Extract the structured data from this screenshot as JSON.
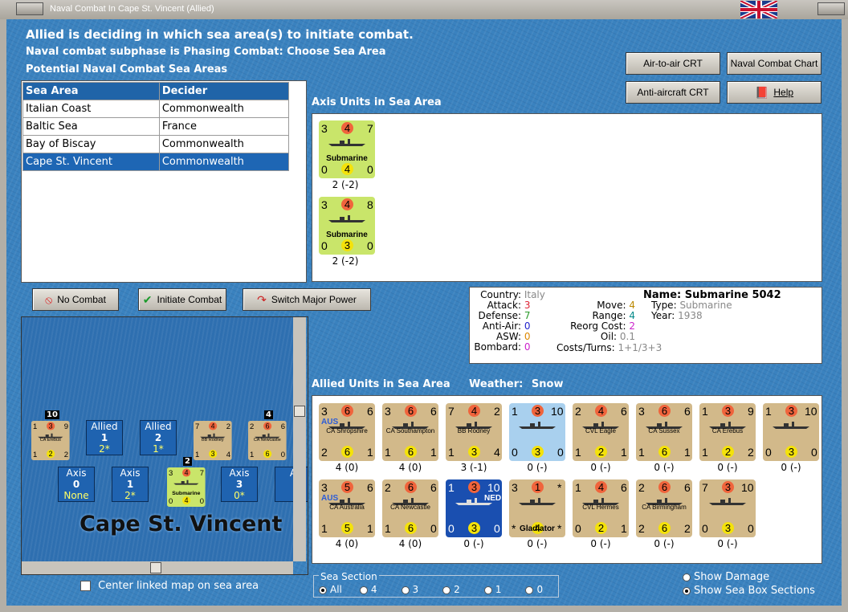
{
  "window": {
    "title": "Naval Combat In Cape St. Vincent (Allied)"
  },
  "header": {
    "line1": "Allied is deciding in which sea area(s) to initiate combat.",
    "line2": "Naval combat subphase is Phasing Combat: Choose Sea Area",
    "line3": "Potential Naval Combat Sea Areas"
  },
  "buttons": {
    "air_to_air": "Air-to-air CRT",
    "naval_chart": "Naval Combat Chart",
    "anti_aircraft": "Anti-aircraft CRT",
    "help": "Help",
    "no_combat": "No Combat",
    "initiate_combat": "Initiate Combat",
    "switch_major": "Switch Major Power"
  },
  "sea_table": {
    "headers": [
      "Sea Area",
      "Decider"
    ],
    "rows": [
      {
        "area": "Italian Coast",
        "decider": "Commonwealth"
      },
      {
        "area": "Baltic Sea",
        "decider": "France"
      },
      {
        "area": "Bay of Biscay",
        "decider": "Commonwealth"
      },
      {
        "area": "Cape St. Vincent",
        "decider": "Commonwealth"
      }
    ]
  },
  "axis_units": {
    "title": "Axis Units in Sea Area",
    "units": [
      {
        "tl": "3",
        "tc": "4",
        "tr": "7",
        "name": "Submarine",
        "bl": "0",
        "bc": "4",
        "br": "0",
        "under": "2 (-2)"
      },
      {
        "tl": "3",
        "tc": "4",
        "tr": "8",
        "name": "Submarine",
        "bl": "0",
        "bc": "3",
        "br": "0",
        "under": "2 (-2)"
      }
    ]
  },
  "info": {
    "country_k": "Country:",
    "country_v": "Italy",
    "attack_k": "Attack:",
    "attack_v": "3",
    "defense_k": "Defense:",
    "defense_v": "7",
    "antiair_k": "Anti-Air:",
    "antiair_v": "0",
    "asw_k": "ASW:",
    "asw_v": "0",
    "bombard_k": "Bombard:",
    "bombard_v": "0",
    "name_k": "Name:",
    "name_v": "Submarine 5042",
    "type_k": "Type:",
    "type_v": "Submarine",
    "year_k": "Year:",
    "year_v": "1938",
    "move_k": "Move:",
    "move_v": "4",
    "range_k": "Range:",
    "range_v": "4",
    "reorg_k": "Reorg Cost:",
    "reorg_v": "2",
    "oil_k": "Oil:",
    "oil_v": "0.1",
    "costs_k": "Costs/Turns:",
    "costs_v": "1+1/3+3"
  },
  "allied_units": {
    "title": "Allied Units in Sea Area",
    "weather_label": "Weather:",
    "weather_value": "Snow",
    "units": [
      {
        "tl": "3",
        "tc": "6",
        "tr": "6",
        "name": "CA Shropshire",
        "tag": "AUS",
        "bl": "2",
        "bc": "6",
        "br": "1",
        "under": "4 (0)",
        "bg": "#d2b98a"
      },
      {
        "tl": "3",
        "tc": "6",
        "tr": "6",
        "name": "CA Southampton",
        "tag": "",
        "bl": "1",
        "bc": "6",
        "br": "1",
        "under": "4 (0)",
        "bg": "#d2b98a"
      },
      {
        "tl": "7",
        "tc": "4",
        "tr": "2",
        "name": "BB Rodney",
        "tag": "",
        "bl": "1",
        "bc": "3",
        "br": "4",
        "under": "3 (-1)",
        "bg": "#d2b98a"
      },
      {
        "tl": "1",
        "tc": "3",
        "tr": "10",
        "name": "",
        "tag": "",
        "bl": "0",
        "bc": "3",
        "br": "0",
        "under": "0 (-)",
        "bg": "#a9d0ee"
      },
      {
        "tl": "2",
        "tc": "4",
        "tr": "6",
        "name": "CVL Eagle",
        "tag": "",
        "bl": "1",
        "bc": "2",
        "br": "1",
        "under": "0 (-)",
        "bg": "#d2b98a"
      },
      {
        "tl": "3",
        "tc": "6",
        "tr": "6",
        "name": "CA Sussex",
        "tag": "",
        "bl": "1",
        "bc": "6",
        "br": "1",
        "under": "0 (-)",
        "bg": "#d2b98a"
      },
      {
        "tl": "1",
        "tc": "3",
        "tr": "9",
        "name": "CA Erebus",
        "tag": "",
        "bl": "1",
        "bc": "2",
        "br": "2",
        "under": "0 (-)",
        "bg": "#d2b98a"
      },
      {
        "tl": "1",
        "tc": "3",
        "tr": "10",
        "name": "",
        "tag": "",
        "bl": "0",
        "bc": "3",
        "br": "0",
        "under": "0 (-)",
        "bg": "#d2b98a"
      },
      {
        "tl": "3",
        "tc": "5",
        "tr": "6",
        "name": "CA Australia",
        "tag": "AUS",
        "bl": "1",
        "bc": "5",
        "br": "1",
        "under": "4 (0)",
        "bg": "#d2b98a"
      },
      {
        "tl": "2",
        "tc": "6",
        "tr": "6",
        "name": "CA Newcastle",
        "tag": "",
        "bl": "1",
        "bc": "6",
        "br": "0",
        "under": "4 (0)",
        "bg": "#d2b98a"
      },
      {
        "tl": "1",
        "tc": "3",
        "tr": "10",
        "name": "",
        "tag": "NED",
        "bl": "0",
        "bc": "3",
        "br": "0",
        "under": "0 (-)",
        "bg": "#1a4fb0"
      },
      {
        "tl": "3",
        "tc": "1",
        "tr": "*",
        "name": "Gladiator",
        "tag": "",
        "bl": "*",
        "bc": "4",
        "br": "*",
        "under": "0 (-)",
        "bg": "#d2b98a"
      },
      {
        "tl": "1",
        "tc": "4",
        "tr": "6",
        "name": "CVL Hermes",
        "tag": "",
        "bl": "0",
        "bc": "2",
        "br": "1",
        "under": "0 (-)",
        "bg": "#d2b98a"
      },
      {
        "tl": "2",
        "tc": "6",
        "tr": "6",
        "name": "CA Birmingham",
        "tag": "",
        "bl": "2",
        "bc": "6",
        "br": "2",
        "under": "0 (-)",
        "bg": "#d2b98a"
      },
      {
        "tl": "7",
        "tc": "3",
        "tr": "10",
        "name": "",
        "tag": "",
        "bl": "0",
        "bc": "3",
        "br": "0",
        "under": "0 (-)",
        "bg": "#d2b98a"
      }
    ]
  },
  "map": {
    "sea_name": "Cape St. Vincent",
    "allied_boxes": [
      {
        "label": "Allied",
        "num": "1",
        "sub": "2*"
      },
      {
        "label": "Allied",
        "num": "2",
        "sub": "1*"
      }
    ],
    "axis_boxes": [
      {
        "label": "Axis",
        "num": "0",
        "sub": "None"
      },
      {
        "label": "Axis",
        "num": "1",
        "sub": "2*"
      },
      {
        "label": "Axis",
        "num": "3",
        "sub": "0*"
      },
      {
        "label": "A",
        "num": "",
        "sub": ""
      }
    ],
    "stack_counts": [
      "10",
      "4",
      "2"
    ],
    "map_counters": [
      {
        "tl": "1",
        "tc": "3",
        "tr": "9",
        "name": "CA Erebus",
        "bl": "1",
        "bc": "2",
        "br": "2"
      },
      {
        "tl": "7",
        "tc": "4",
        "tr": "2",
        "name": "BB Rodney",
        "bl": "1",
        "bc": "3",
        "br": "4"
      },
      {
        "tl": "2",
        "tc": "6",
        "tr": "6",
        "name": "CA Newcastle",
        "bl": "1",
        "bc": "6",
        "br": "0"
      },
      {
        "tl": "3",
        "tc": "4",
        "tr": "7",
        "name": "Submarine",
        "bl": "0",
        "bc": "4",
        "br": "0"
      }
    ]
  },
  "options": {
    "center_linked": "Center linked map on sea area",
    "sea_section_label": "Sea Section",
    "sections": [
      "All",
      "4",
      "3",
      "2",
      "1",
      "0"
    ],
    "show_damage": "Show Damage",
    "show_sections": "Show Sea Box Sections"
  },
  "colors": {
    "attack": "#f0643c",
    "defense_yellow": "#f4e20a",
    "axis_counter": "#c9e56a",
    "header_blue": "#2064a8"
  }
}
